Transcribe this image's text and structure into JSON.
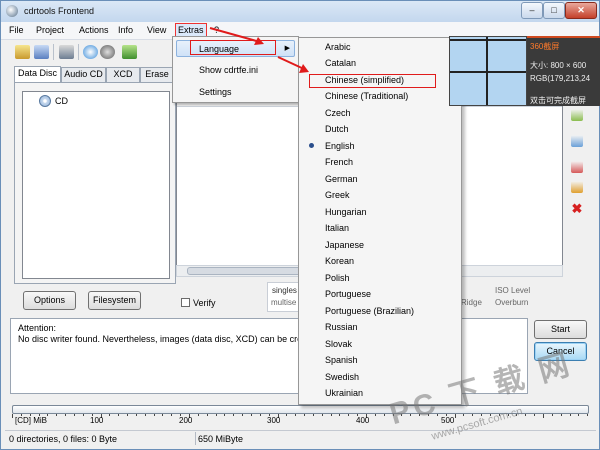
{
  "window": {
    "title": "cdrtools Frontend",
    "controls": {
      "minimize": "–",
      "maximize": "□",
      "close": "✕"
    }
  },
  "menubar": [
    "File",
    "Project",
    "Actions",
    "Info",
    "View",
    "Extras",
    "?"
  ],
  "toolbar_icons": [
    "new-project-icon",
    "open-project-icon",
    "wrench-icon",
    "add-files-icon",
    "stop-icon",
    "export-icon"
  ],
  "tabs": [
    "Data Disc",
    "Audio CD",
    "XCD",
    "Erase"
  ],
  "tree": {
    "root": "CD"
  },
  "buttons": {
    "options": "Options",
    "filesystem": "Filesystem",
    "help_glyph": "✔",
    "start": "Start",
    "cancel": "Cancel"
  },
  "verify_label": "Verify",
  "partial_labels": {
    "single": "singles",
    "multi": "multise",
    "ridge": "Ridge",
    "iso_level": "ISO Level",
    "overburn": "Overburn"
  },
  "status": {
    "attention": "Attention:",
    "message": "No disc writer found. Nevertheless, images (data disc, XCD) can be crea"
  },
  "ruler": {
    "unit_label": "[CD] MiB",
    "ticks": [
      "100",
      "200",
      "300",
      "400",
      "500"
    ]
  },
  "statusbar": {
    "counts": "0 directories, 0 files: 0 Byte",
    "capacity": "650 MiByte"
  },
  "extras_menu": {
    "language": "Language",
    "show_ini": "Show cdrtfe.ini",
    "settings": "Settings"
  },
  "language_menu": {
    "selected": "English",
    "highlighted": "Chinese (simplified)",
    "items": [
      "Arabic",
      "Catalan",
      "Chinese (simplified)",
      "Chinese (Traditional)",
      "Czech",
      "Dutch",
      "English",
      "French",
      "German",
      "Greek",
      "Hungarian",
      "Italian",
      "Japanese",
      "Korean",
      "Polish",
      "Portuguese",
      "Portuguese (Brazilian)",
      "Russian",
      "Slovak",
      "Spanish",
      "Swedish",
      "Ukrainian"
    ]
  },
  "screenshot_tool": {
    "title": "360截屏",
    "size": "大小: 800 × 600",
    "rgb": "RGB(179,213,24",
    "hint": "双击可完成截屏"
  },
  "watermark": {
    "text": "PC 下 载 网",
    "url": "www.pcsoft.com.cn"
  },
  "colors": {
    "highlight_border": "#e01b1b",
    "grid_fill": "#b3d5f1",
    "menu_hover": "#cfe2f7"
  }
}
